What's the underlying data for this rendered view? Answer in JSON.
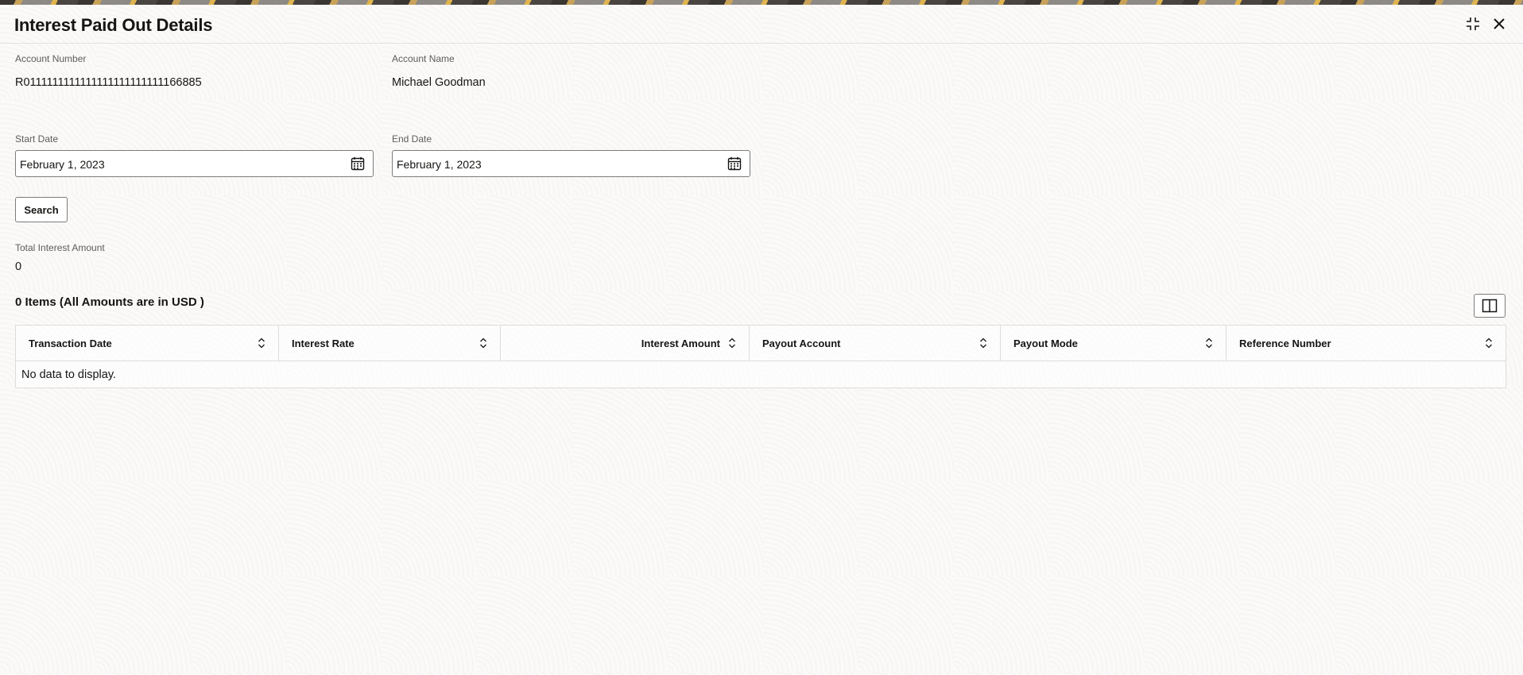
{
  "dialog": {
    "title": "Interest Paid Out Details"
  },
  "account": {
    "number_label": "Account Number",
    "number_value": "R0111111111111111111111111166885",
    "name_label": "Account Name",
    "name_value": "Michael Goodman"
  },
  "filters": {
    "start_label": "Start Date",
    "start_value": "February 1, 2023",
    "end_label": "End Date",
    "end_value": "February 1, 2023",
    "search_label": "Search"
  },
  "summary": {
    "total_label": "Total Interest Amount",
    "total_value": "0"
  },
  "table": {
    "items_label": "0 Items (All Amounts are in USD )",
    "columns": [
      "Transaction Date",
      "Interest Rate",
      "Interest Amount",
      "Payout Account",
      "Payout Mode",
      "Reference Number"
    ],
    "empty_message": "No data to display."
  },
  "icons": {
    "maximize": "maximize-icon",
    "close": "close-icon",
    "calendar": "calendar-icon",
    "sort": "sort-icon",
    "columns": "column-toggle-icon"
  }
}
